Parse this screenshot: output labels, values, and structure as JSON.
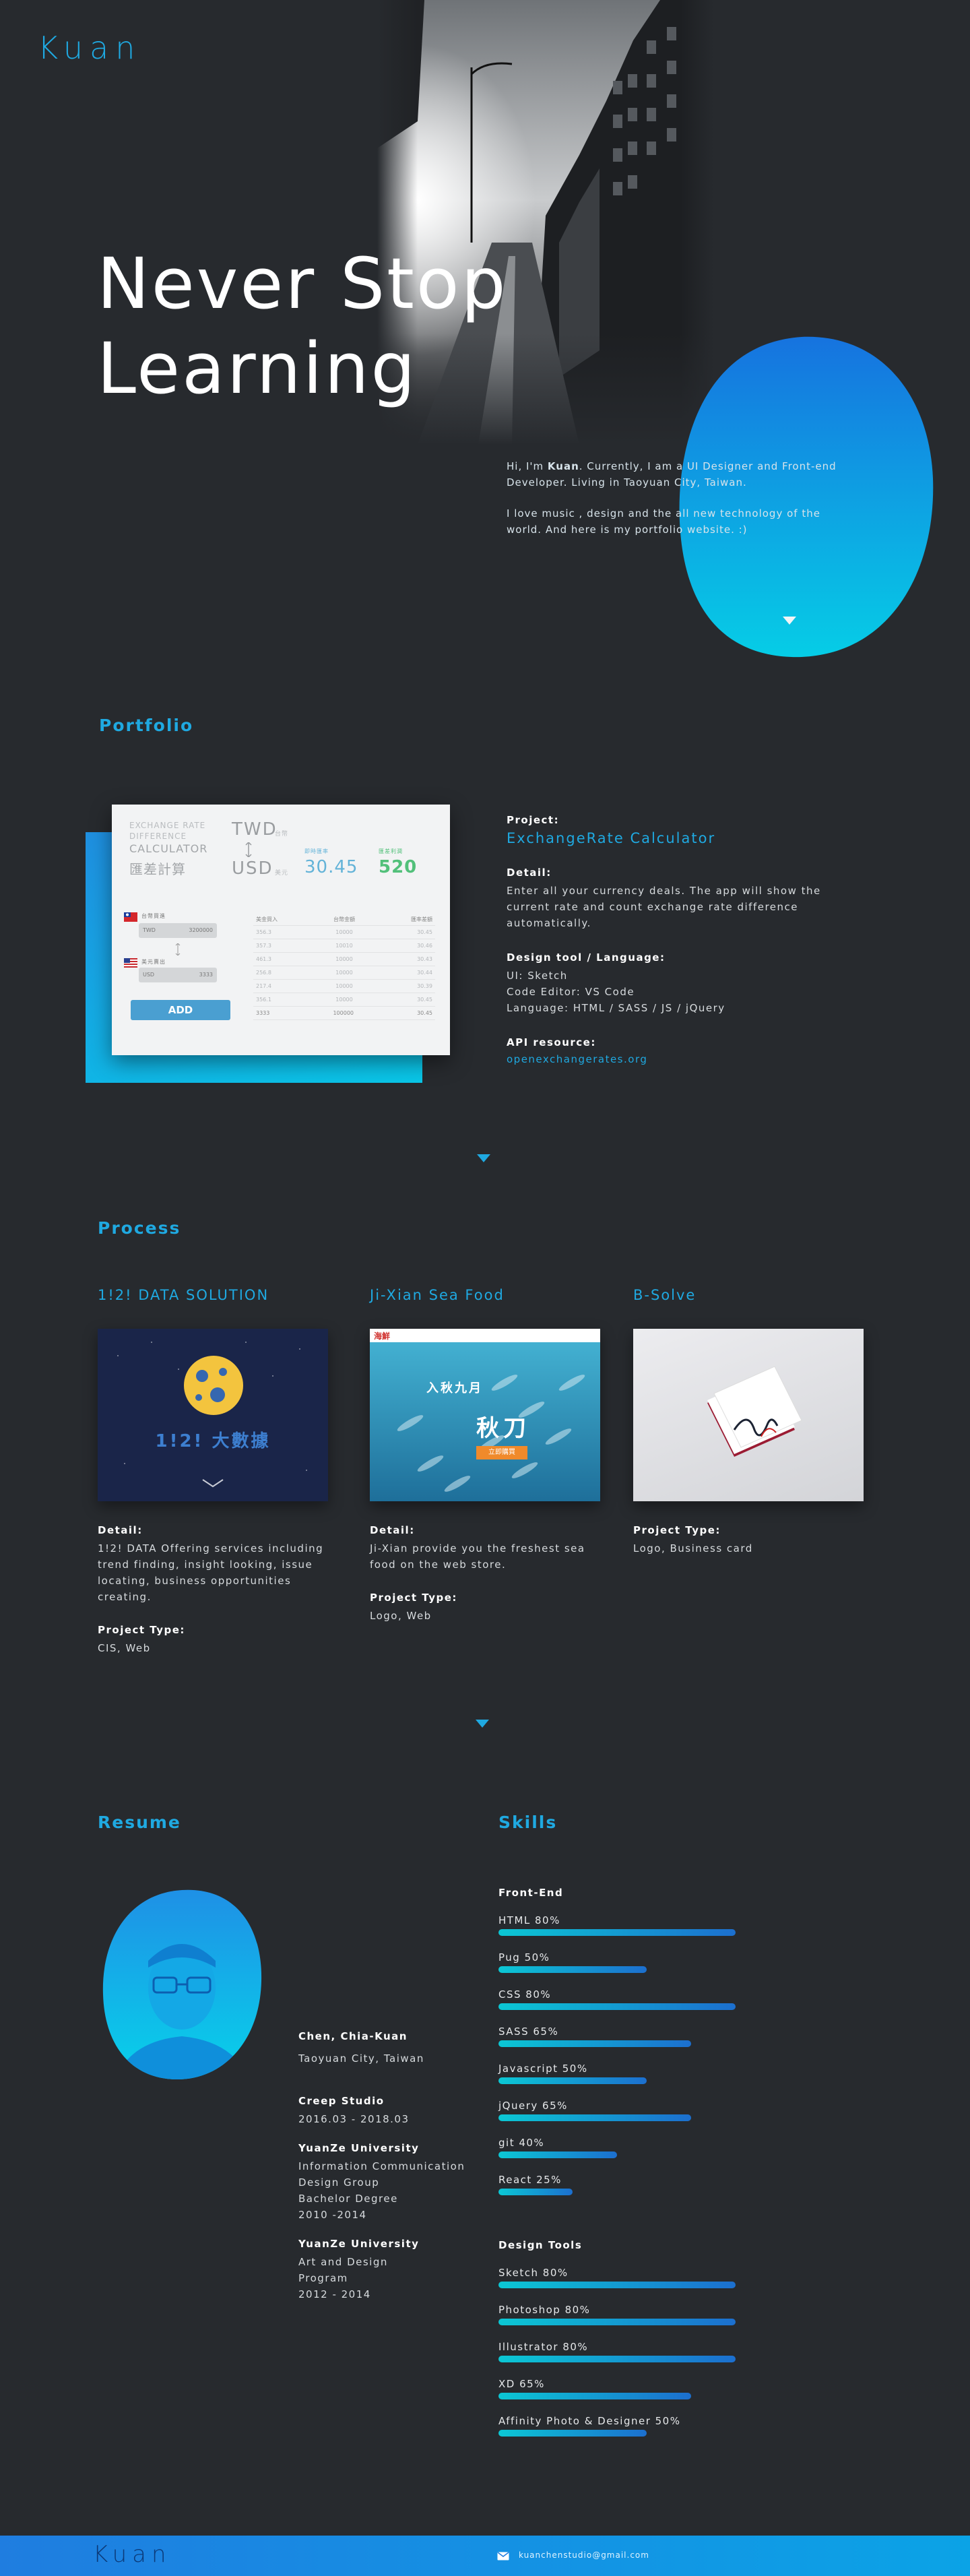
{
  "header": {
    "logo": "Kuan"
  },
  "hero": {
    "title_line1": "Never Stop",
    "title_line2": "Learning",
    "intro_p1_pre": "Hi, I'm ",
    "intro_name": "Kuan",
    "intro_p1_post": ". Currently, I am a UI Designer and Front-end Developer. Living in Taoyuan City, Taiwan.",
    "intro_p2": "I love music , design and the all new technology of the world. And here is my portfolio website. :)",
    "scroll_icon": "chevron-down-icon"
  },
  "portfolio": {
    "title": "Portfolio",
    "app": {
      "subtitle1": "EXCHANGE RATE",
      "subtitle2": "DIFFERENCE",
      "subtitle3": "CALCULATOR",
      "subtitle_cn": "匯差計算",
      "cur1": "TWD",
      "cur1_cn": "台幣",
      "cur2": "USD",
      "cur2_cn": "美元",
      "rate_label1": "即時匯率",
      "rate_label2": "匯差利潤",
      "rate1": "30.45",
      "rate2": "520",
      "in_label": "台幣買進",
      "out_label": "美元賣出",
      "field1_cur": "TWD",
      "field1_val": "3200000",
      "field2_cur": "USD",
      "field2_val": "3333",
      "add_label": "ADD",
      "table_head": [
        "美金買入",
        "台幣金額",
        "匯率差額"
      ],
      "table_rows": [
        [
          "356.3",
          "10000",
          "30.45"
        ],
        [
          "357.3",
          "10010",
          "30.46"
        ],
        [
          "461.3",
          "10000",
          "30.43"
        ],
        [
          "256.8",
          "10000",
          "30.44"
        ],
        [
          "217.4",
          "10000",
          "30.39"
        ],
        [
          "356.1",
          "10000",
          "30.45"
        ]
      ],
      "table_total": [
        "3333",
        "100000",
        "30.45"
      ]
    },
    "project_label": "Project:",
    "project_value": "ExchangeRate Calculator",
    "detail_label": "Detail:",
    "detail_value": "Enter all your currency deals. The app will show the current rate and count exchange rate difference automatically.",
    "tools_label": "Design tool / Language:",
    "tools_ui": "UI: Sketch",
    "tools_editor": "Code Editor: VS Code",
    "tools_lang": "Language: HTML / SASS / JS / jQuery",
    "api_label": "API resource:",
    "api_value": "openexchangerates.org"
  },
  "process": {
    "title": "Process",
    "items": [
      {
        "name": "1!2! DATA SOLUTION",
        "image_text": "1!2! 大數據",
        "detail_label": "Detail:",
        "detail": "1!2! DATA Offering services including trend finding, insight looking, issue locating, business opportunities creating.",
        "type_label": "Project Type:",
        "type": "CIS, Web"
      },
      {
        "name": "Ji-Xian Sea Food",
        "image_text_1": "入秋九月",
        "image_text_2": "秋刀",
        "image_button": "立即購買",
        "image_logo": "海鮮",
        "detail_label": "Detail:",
        "detail": "Ji-Xian provide you the freshest sea food on the web store.",
        "type_label": "Project Type:",
        "type": "Logo, Web"
      },
      {
        "name": "B-Solve",
        "type_label": "Project Type:",
        "type": "Logo, Business card"
      }
    ]
  },
  "resume": {
    "title": "Resume",
    "name": "Chen, Chia-Kuan",
    "location": "Taoyuan City, Taiwan",
    "jobs": [
      {
        "org": "Creep Studio",
        "lines": [
          "2016.03 - 2018.03"
        ]
      },
      {
        "org": "YuanZe University",
        "lines": [
          "Information Communication",
          "Design Group",
          "Bachelor Degree",
          "2010 -2014"
        ]
      },
      {
        "org": "YuanZe University",
        "lines": [
          "Art and Design",
          "Program",
          "2012 - 2014"
        ]
      }
    ]
  },
  "skills": {
    "title": "Skills",
    "groups": [
      {
        "title": "Front-End",
        "items": [
          {
            "label": "HTML 80%",
            "level": 0.8
          },
          {
            "label": "Pug 50%",
            "level": 0.5
          },
          {
            "label": "CSS 80%",
            "level": 0.8
          },
          {
            "label": "SASS 65%",
            "level": 0.65
          },
          {
            "label": "Javascript 50%",
            "level": 0.5
          },
          {
            "label": "jQuery 65%",
            "level": 0.65
          },
          {
            "label": "git 40%",
            "level": 0.4
          },
          {
            "label": "React 25%",
            "level": 0.25
          }
        ]
      },
      {
        "title": "Design Tools",
        "items": [
          {
            "label": "Sketch 80%",
            "level": 0.8
          },
          {
            "label": "Photoshop 80%",
            "level": 0.8
          },
          {
            "label": "Illustrator 80%",
            "level": 0.8
          },
          {
            "label": "XD 65%",
            "level": 0.65
          },
          {
            "label": "Affinity Photo & Designer 50%",
            "level": 0.5
          }
        ]
      }
    ]
  },
  "footer": {
    "logo": "Kuan",
    "email": "kuanchenstudio@gmail.com"
  }
}
